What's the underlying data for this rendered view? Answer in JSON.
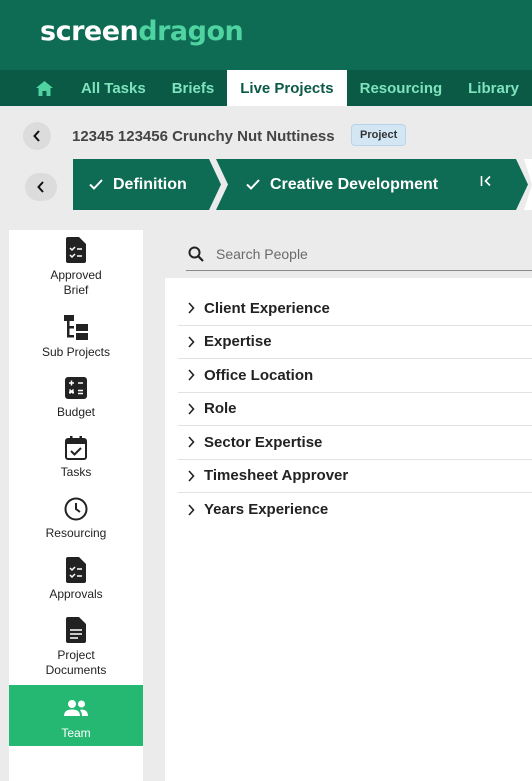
{
  "brand": {
    "logo_part1": "screen",
    "logo_part2": "dragon"
  },
  "nav": {
    "home_icon": "home-icon",
    "items": [
      {
        "label": "All Tasks",
        "active": false
      },
      {
        "label": "Briefs",
        "active": false
      },
      {
        "label": "Live Projects",
        "active": true
      },
      {
        "label": "Resourcing",
        "active": false
      },
      {
        "label": "Library",
        "active": false
      }
    ]
  },
  "project": {
    "title": "12345 123456 Crunchy Nut Nuttiness",
    "badge": "Project"
  },
  "stages": [
    {
      "label": "Definition",
      "completed": true
    },
    {
      "label": "Creative Development",
      "completed": true,
      "current": true
    }
  ],
  "sidebar": {
    "items": [
      {
        "label": "Approved Brief",
        "icon": "approved-brief-icon"
      },
      {
        "label": "Sub Projects",
        "icon": "sub-projects-icon"
      },
      {
        "label": "Budget",
        "icon": "budget-icon"
      },
      {
        "label": "Tasks",
        "icon": "tasks-icon"
      },
      {
        "label": "Resourcing",
        "icon": "resourcing-icon"
      },
      {
        "label": "Approvals",
        "icon": "approvals-icon"
      },
      {
        "label": "Project Documents",
        "icon": "project-documents-icon"
      },
      {
        "label": "Team",
        "icon": "team-icon",
        "active": true
      }
    ]
  },
  "search": {
    "placeholder": "Search People",
    "value": ""
  },
  "filters": [
    "Client Experience",
    "Expertise",
    "Office Location",
    "Role",
    "Sector Expertise",
    "Timesheet Approver",
    "Years Experience"
  ],
  "colors": {
    "brand": "#0e6b54",
    "nav_bg": "#0a5a46",
    "nav_text": "#7fe3bd",
    "active_green": "#25b872",
    "badge_bg": "#d3e6f4"
  }
}
